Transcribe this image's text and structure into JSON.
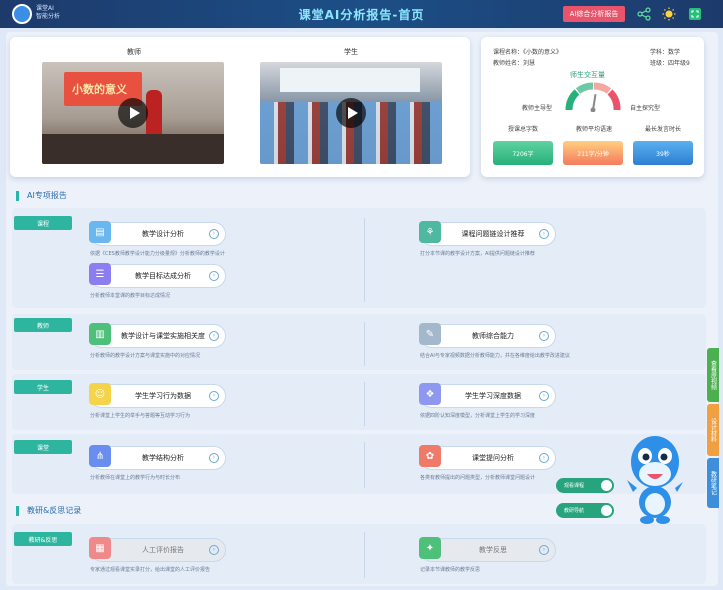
{
  "header": {
    "logo_text_line1": "课堂AI",
    "logo_text_line2": "智能分析",
    "title": "课堂AI分析报告-首页",
    "comprehensive_button": "AI综合分析报告",
    "icons": [
      "share-icon",
      "sun-icon",
      "fullscreen-icon"
    ]
  },
  "videos": {
    "teacher_label": "教师",
    "student_label": "学生",
    "teacher_board_text": "小数的意义"
  },
  "lesson_info": {
    "course_name": "课程名称：《小数的意义》",
    "subject": "学科：数学",
    "teacher_name": "教师姓名：刘慧",
    "class": "班级：四年级9",
    "gauge_title": "师生交互量",
    "gauge_left": "教师主导型",
    "gauge_right": "自主探究型",
    "stat_labels": [
      "授课总字数",
      "教师平均语速",
      "最长发言时长"
    ],
    "stat_values": [
      "7206字",
      "211字/分钟",
      "39秒"
    ],
    "gauge_value_fraction": 0.55
  },
  "ai_report": {
    "section_title": "AI专项报告",
    "groups": [
      {
        "tag": "课程",
        "items": [
          {
            "label": "教学设计分析",
            "desc": "依据《CES教师教学设计能力分级量规》分析教师的教学设计",
            "icon": "document-icon"
          },
          {
            "label": "课程问题链设计推荐",
            "desc": "打分本节课的教学设计方案，AI提供问题链设计推荐",
            "icon": "flow-icon"
          },
          {
            "label": "教学目标达成分析",
            "desc": "分析教师本堂课的教学目标达成情况",
            "icon": "clipboard-icon"
          }
        ]
      },
      {
        "tag": "教师",
        "items": [
          {
            "label": "教学设计与课堂实施相关度",
            "desc": "分析教师的教学设计方案与课堂实施中的对应情况",
            "icon": "book-icon"
          },
          {
            "label": "教师综合能力",
            "desc": "结合AI与专家视频数据分析教师能力，并在各维度给出教学改进建议",
            "icon": "edit-icon"
          }
        ]
      },
      {
        "tag": "学生",
        "items": [
          {
            "label": "学生学习行为数据",
            "desc": "分析课堂上学生的举手与答题等互动学习行为",
            "icon": "student-icon"
          },
          {
            "label": "学生学习深度数据",
            "desc": "依据四阶认知深度模型，分析课堂上学生的学习深度",
            "icon": "brain-icon"
          }
        ]
      },
      {
        "tag": "课堂",
        "items": [
          {
            "label": "教学结构分析",
            "desc": "分析教师在课堂上的教学行为与时长分布",
            "icon": "structure-icon"
          },
          {
            "label": "课堂提问分析",
            "desc": "各类有教师提出的问题类型，分析教师课堂问题设计",
            "icon": "question-icon"
          }
        ]
      }
    ]
  },
  "reflection": {
    "section_title": "教研&反思记录",
    "tag": "教研&反思",
    "items": [
      {
        "label": "人工评价报告",
        "desc": "专家通过观看课堂实录打分，给出课堂的人工评价报告",
        "icon": "grid-icon"
      },
      {
        "label": "教学反思",
        "desc": "记录本节课教师的教学反思",
        "icon": "bulb-icon"
      }
    ]
  },
  "pills": [
    "观看课程",
    "教研导航"
  ],
  "side_tabs": [
    {
      "label": "查看原视频",
      "color": "#4caf50"
    },
    {
      "label": "设计材料",
      "color": "#f0a040"
    },
    {
      "label": "教研笔记",
      "color": "#3d8fd9"
    }
  ]
}
